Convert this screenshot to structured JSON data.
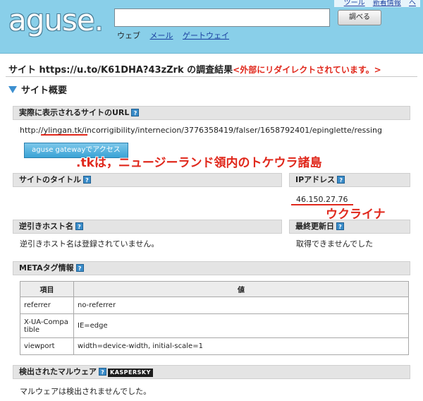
{
  "header": {
    "logo": "aguse.",
    "search_value": "",
    "search_button": "調べる",
    "nav": [
      "ウェブ",
      "メール",
      "ゲートウェイ"
    ],
    "top_links": [
      "ツール",
      "新着情報",
      "ヘ"
    ]
  },
  "result": {
    "title": "サイト https://u.to/K61DHA?43zZrk の調査結果",
    "redirect_note": "<外部にリダイレクトされています。>"
  },
  "summary": {
    "title": "サイト概要"
  },
  "sections": {
    "actual_url": {
      "label": "実際に表示されるサイトのURL",
      "url": "http://ylingan.tk/incorrigibility/internecion/3776358419/falser/1658792401/epinglette/ressing",
      "gateway_button": "aguse gatewayでアクセス"
    },
    "site_title": {
      "label": "サイトのタイトル",
      "value": ""
    },
    "ip": {
      "label": "IPアドレス",
      "value": "46.150.27.76"
    },
    "reverse_host": {
      "label": "逆引きホスト名",
      "value": "逆引きホスト名は登録されていません。"
    },
    "last_updated": {
      "label": "最終更新日",
      "value": "取得できませんでした"
    },
    "meta": {
      "label": "METAタグ情報",
      "headers": [
        "項目",
        "値"
      ],
      "rows": [
        [
          "referrer",
          "no-referrer"
        ],
        [
          "X-UA-Compatible",
          "IE=edge"
        ],
        [
          "viewport",
          "width=device-width, initial-scale=1"
        ]
      ]
    },
    "malware": {
      "label": "検出されたマルウェア",
      "logo": "KASPERSKY",
      "value": "マルウェアは検出されませんでした。"
    }
  },
  "annotations": {
    "tk_note": ".tkは，ニュージーランド領内のトケウラ諸島",
    "ip_note": "ウクライナ"
  },
  "help_glyph": "?",
  "colors": {
    "header_bg": "#89cfe9",
    "annotation_red": "#e0281c",
    "section_bar": "#e4e4e4",
    "link_blue": "#1a3fa0"
  }
}
